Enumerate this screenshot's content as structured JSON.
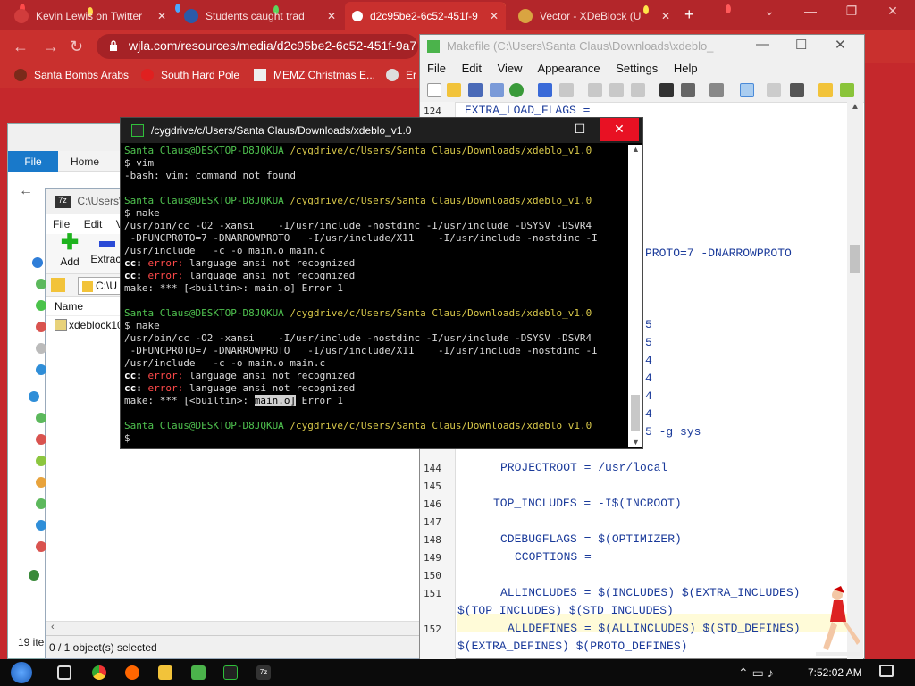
{
  "browser": {
    "tabs": [
      {
        "title": "Kevin Lewis on Twitter",
        "active": false
      },
      {
        "title": "Students caught trad",
        "active": false
      },
      {
        "title": "d2c95be2-6c52-451f-9",
        "active": true
      },
      {
        "title": "Vector - XDeBlock (U",
        "active": false
      }
    ],
    "address": "wjla.com/resources/media/d2c95be2-6c52-451f-9a7",
    "bookmarks": [
      "Santa Bombs Arabs",
      "South Hard Pole",
      "MEMZ Christmas E...",
      "Er"
    ]
  },
  "explorer": {
    "file_tab": "File",
    "home_tab": "Home",
    "address_fragment": "xde"
  },
  "zip": {
    "title": "C:\\Users\\",
    "menu": [
      "File",
      "Edit",
      "Vi"
    ],
    "tools": [
      "Add",
      "Extract"
    ],
    "address": "C:\\U",
    "column_name": "Name",
    "row": "xdeblock10",
    "status": "0 / 1 object(s) selected",
    "left_count": "19 ite"
  },
  "editor": {
    "title": "Makefile (C:\\Users\\Santa Claus\\Downloads\\xdeblo_",
    "menu": [
      "File",
      "Edit",
      "View",
      "Appearance",
      "Settings",
      "Help"
    ],
    "lines": [
      {
        "num": "124",
        "text": "EXTRA_LOAD_FLAGS ="
      },
      {
        "num": "",
        "text": "PROTO=7 -DNARROWPROTO"
      },
      {
        "num": "",
        "text": "5"
      },
      {
        "num": "",
        "text": "5"
      },
      {
        "num": "",
        "text": "4"
      },
      {
        "num": "",
        "text": "4"
      },
      {
        "num": "",
        "text": "4"
      },
      {
        "num": "",
        "text": "4"
      },
      {
        "num": "",
        "text": "5 -g sys"
      },
      {
        "num": "144",
        "text": "PROJECTROOT = /usr/local"
      },
      {
        "num": "145",
        "text": ""
      },
      {
        "num": "146",
        "text": "TOP_INCLUDES = -I$(INCROOT)"
      },
      {
        "num": "147",
        "text": ""
      },
      {
        "num": "148",
        "text": "CDEBUGFLAGS = $(OPTIMIZER)"
      },
      {
        "num": "149",
        "text": "CCOPTIONS ="
      },
      {
        "num": "150",
        "text": ""
      },
      {
        "num": "151",
        "text": "ALLINCLUDES = $(INCLUDES) $(EXTRA_INCLUDES)"
      },
      {
        "num": "",
        "text": "$(TOP_INCLUDES) $(STD_INCLUDES)"
      },
      {
        "num": "152",
        "text": "ALLDEFINES = $(ALLINCLUDES) $(STD_DEFINES)"
      },
      {
        "num": "",
        "text": "$(EXTRA_DEFINES) $(PROTO_DEFINES)"
      }
    ]
  },
  "terminal": {
    "title": "/cygdrive/c/Users/Santa Claus/Downloads/xdeblo_v1.0",
    "prompt_user": "Santa Claus@DESKTOP-D8JQKUA",
    "prompt_path": "/cygdrive/c/Users/Santa Claus/Downloads/xdeblo_v1.0",
    "cmd_vim": "$ vim",
    "vim_error": "-bash: vim: command not found",
    "cmd_make": "$ make",
    "cc_line1": "/usr/bin/cc -O2 -xansi    -I/usr/include -nostdinc -I/usr/include -DSYSV -DSVR4",
    "cc_line2": " -DFUNCPROTO=7 -DNARROWPROTO   -I/usr/include/X11    -I/usr/include -nostdinc -I",
    "cc_line3": "/usr/include   -c -o main.o main.c",
    "err_prefix": "cc:",
    "err_word": "error:",
    "err_msg": " language ansi not recognized",
    "make_err_a": "make: *** [<builtin>: ",
    "make_err_target": "main.o]",
    "make_err_b": " Error 1",
    "make_err_full": "make: *** [<builtin>: main.o] Error 1",
    "final_prompt": "$"
  },
  "taskbar": {
    "time": "7:52:02 AM"
  },
  "colors": {
    "chrome_red": "#c9302e",
    "term_green": "#4fc24f",
    "term_yellow": "#d8c84a",
    "term_error": "#ff4a4a",
    "editor_code": "#1a3a9a"
  }
}
